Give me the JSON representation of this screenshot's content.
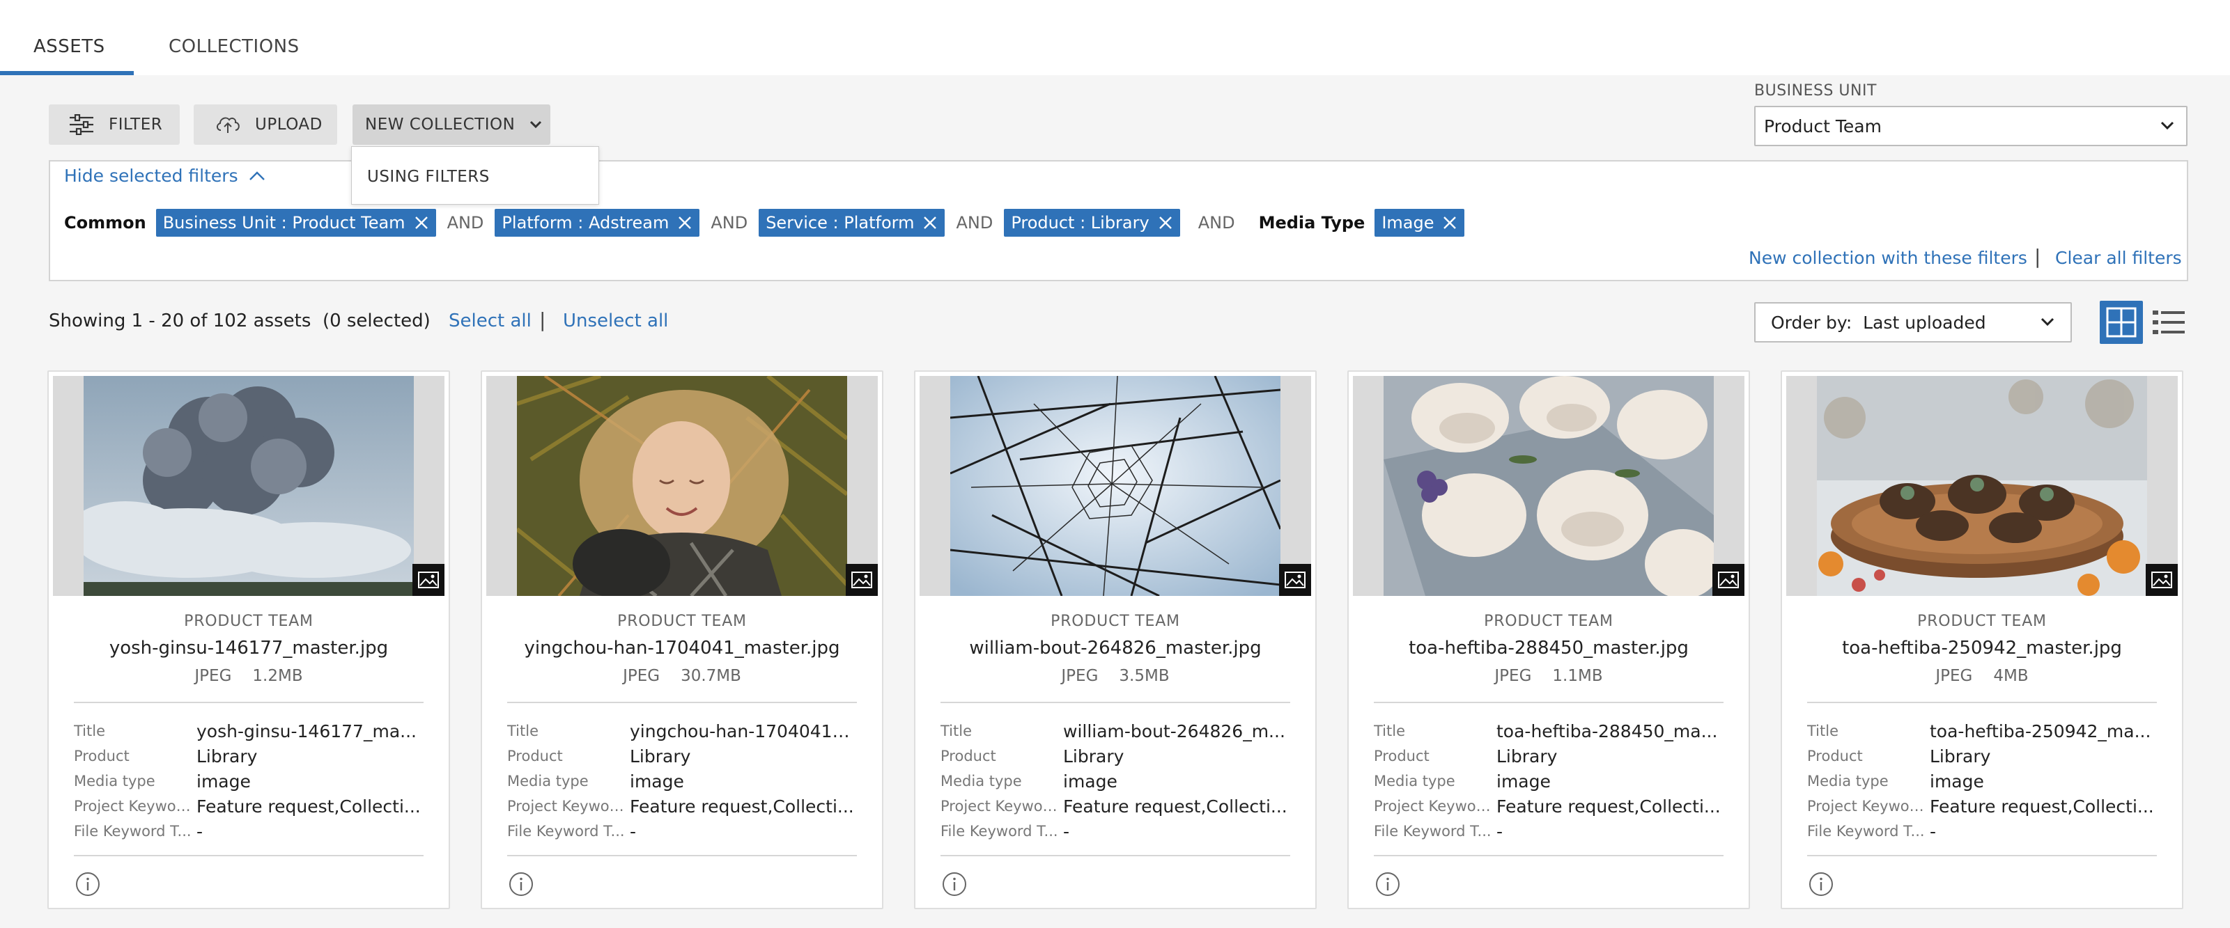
{
  "tabs": [
    {
      "label": "ASSETS",
      "active": true
    },
    {
      "label": "COLLECTIONS",
      "active": false
    }
  ],
  "toolbar": {
    "filter_label": "FILTER",
    "upload_label": "UPLOAD",
    "new_collection_label": "NEW COLLECTION",
    "new_collection_menu": [
      "USING FILTERS"
    ]
  },
  "business_unit": {
    "label": "BUSINESS UNIT",
    "selected": "Product Team"
  },
  "filters": {
    "toggle_label": "Hide selected filters",
    "group_label": "Common",
    "and_label": "AND",
    "chips": [
      "Business Unit : Product Team",
      "Platform : Adstream",
      "Service : Platform",
      "Product : Library"
    ],
    "media_type_label": "Media Type",
    "media_type_chip": "Image",
    "new_collection_link": "New collection with these filters",
    "separator": "|",
    "clear_link": "Clear all filters"
  },
  "results": {
    "showing_text": "Showing 1 - 20 of 102 assets",
    "selected_text": "(0 selected)",
    "select_all": "Select all",
    "separator": "|",
    "unselect_all": "Unselect all",
    "order_label": "Order by:",
    "order_value": "Last uploaded"
  },
  "colors": {
    "accent": "#2f72b8",
    "chip_bg": "#2f72b8",
    "button_bg": "#e2e2e2"
  },
  "field_labels": {
    "title": "Title",
    "product": "Product",
    "media_type": "Media type",
    "project_keywords": "Project Keywor...",
    "file_keyword": "File Keyword T..."
  },
  "assets": [
    {
      "business_unit": "PRODUCT TEAM",
      "filename": "yosh-ginsu-146177_master.jpg",
      "format": "JPEG",
      "size": "1.2MB",
      "title": "yosh-ginsu-146177_ma...",
      "product": "Library",
      "media_type": "image",
      "project_keywords": "Feature request,Collecti...",
      "file_keyword": "-",
      "thumbnail": "volcano-smoke-clouds"
    },
    {
      "business_unit": "PRODUCT TEAM",
      "filename": "yingchou-han-1704041_master.jpg",
      "format": "JPEG",
      "size": "30.7MB",
      "title": "yingchou-han-1704041_...",
      "product": "Library",
      "media_type": "image",
      "project_keywords": "Feature request,Collecti...",
      "file_keyword": "-",
      "thumbnail": "woman-lying-in-ferns"
    },
    {
      "business_unit": "PRODUCT TEAM",
      "filename": "william-bout-264826_master.jpg",
      "format": "JPEG",
      "size": "3.5MB",
      "title": "william-bout-264826_m...",
      "product": "Library",
      "media_type": "image",
      "project_keywords": "Feature request,Collecti...",
      "file_keyword": "-",
      "thumbnail": "geometric-wire-structure"
    },
    {
      "business_unit": "PRODUCT TEAM",
      "filename": "toa-heftiba-288450_master.jpg",
      "format": "JPEG",
      "size": "1.1MB",
      "title": "toa-heftiba-288450_ma...",
      "product": "Library",
      "media_type": "image",
      "project_keywords": "Feature request,Collecti...",
      "file_keyword": "-",
      "thumbnail": "meringues-on-tray"
    },
    {
      "business_unit": "PRODUCT TEAM",
      "filename": "toa-heftiba-250942_master.jpg",
      "format": "JPEG",
      "size": "4MB",
      "title": "toa-heftiba-250942_ma...",
      "product": "Library",
      "media_type": "image",
      "project_keywords": "Feature request,Collecti...",
      "file_keyword": "-",
      "thumbnail": "muffins-on-wood-board"
    }
  ]
}
